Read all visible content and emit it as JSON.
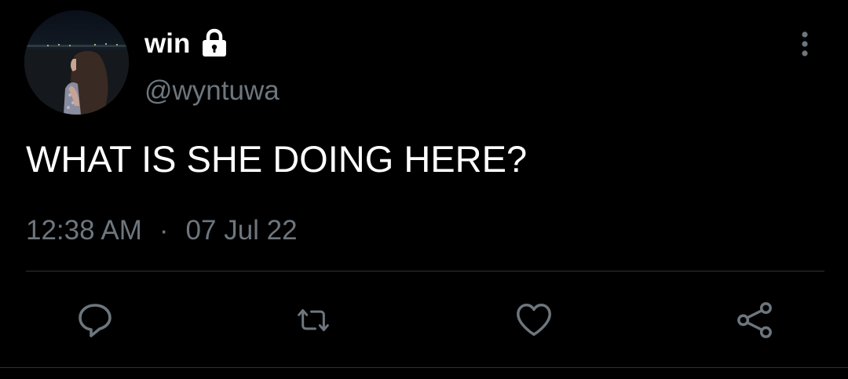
{
  "tweet": {
    "author": {
      "display_name": "win",
      "handle": "@wyntuwa",
      "protected_icon": "lock-icon"
    },
    "text": "WHAT IS SHE DOING HERE?",
    "time": "12:38 AM",
    "separator": "·",
    "date": "07 Jul 22"
  },
  "actions": [
    {
      "icon": "reply-icon"
    },
    {
      "icon": "retweet-icon"
    },
    {
      "icon": "like-icon"
    },
    {
      "icon": "share-icon"
    }
  ],
  "menu": {
    "icon": "more-vertical-icon"
  },
  "colors": {
    "background": "#000000",
    "primary_text": "#ffffff",
    "secondary_text": "#6e767d",
    "divider": "#2f3336"
  }
}
